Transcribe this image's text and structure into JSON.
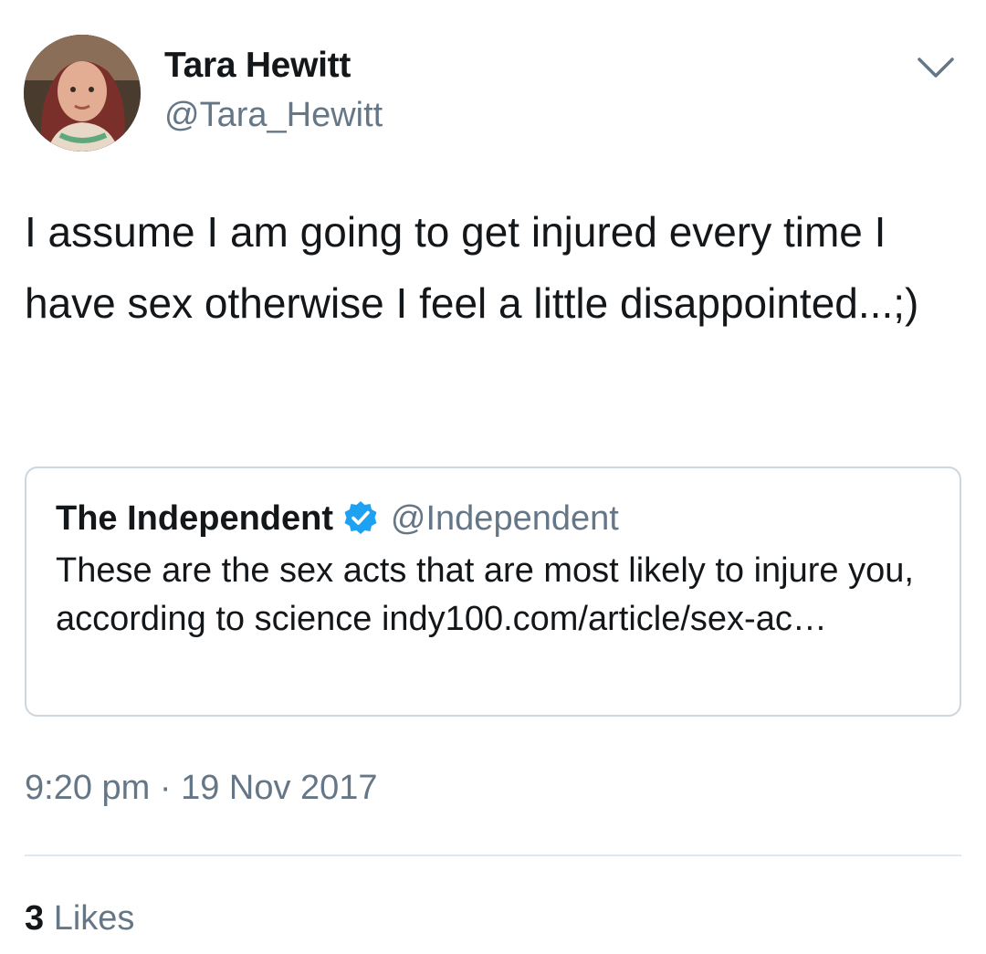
{
  "author": {
    "name": "Tara Hewitt",
    "handle": "@Tara_Hewitt",
    "avatar_icon": "profile-photo"
  },
  "menu_icon": "chevron-down-icon",
  "tweet": {
    "text": "I assume I am going to get injured every time I have sex otherwise I feel a little disappointed...;)"
  },
  "quoted_tweet": {
    "name": "The Independent",
    "verified_icon": "verified-badge-icon",
    "handle": "@Independent",
    "text": "These are the sex acts that are most likely to injure you, according to science indy100.com/article/sex-ac…"
  },
  "timestamp": "9:20 pm · 19 Nov 2017",
  "likes": {
    "count": "3",
    "label": "Likes"
  },
  "colors": {
    "text": "#14171a",
    "secondary": "#657786",
    "border": "#ccd6dd",
    "verified": "#1da1f2"
  }
}
